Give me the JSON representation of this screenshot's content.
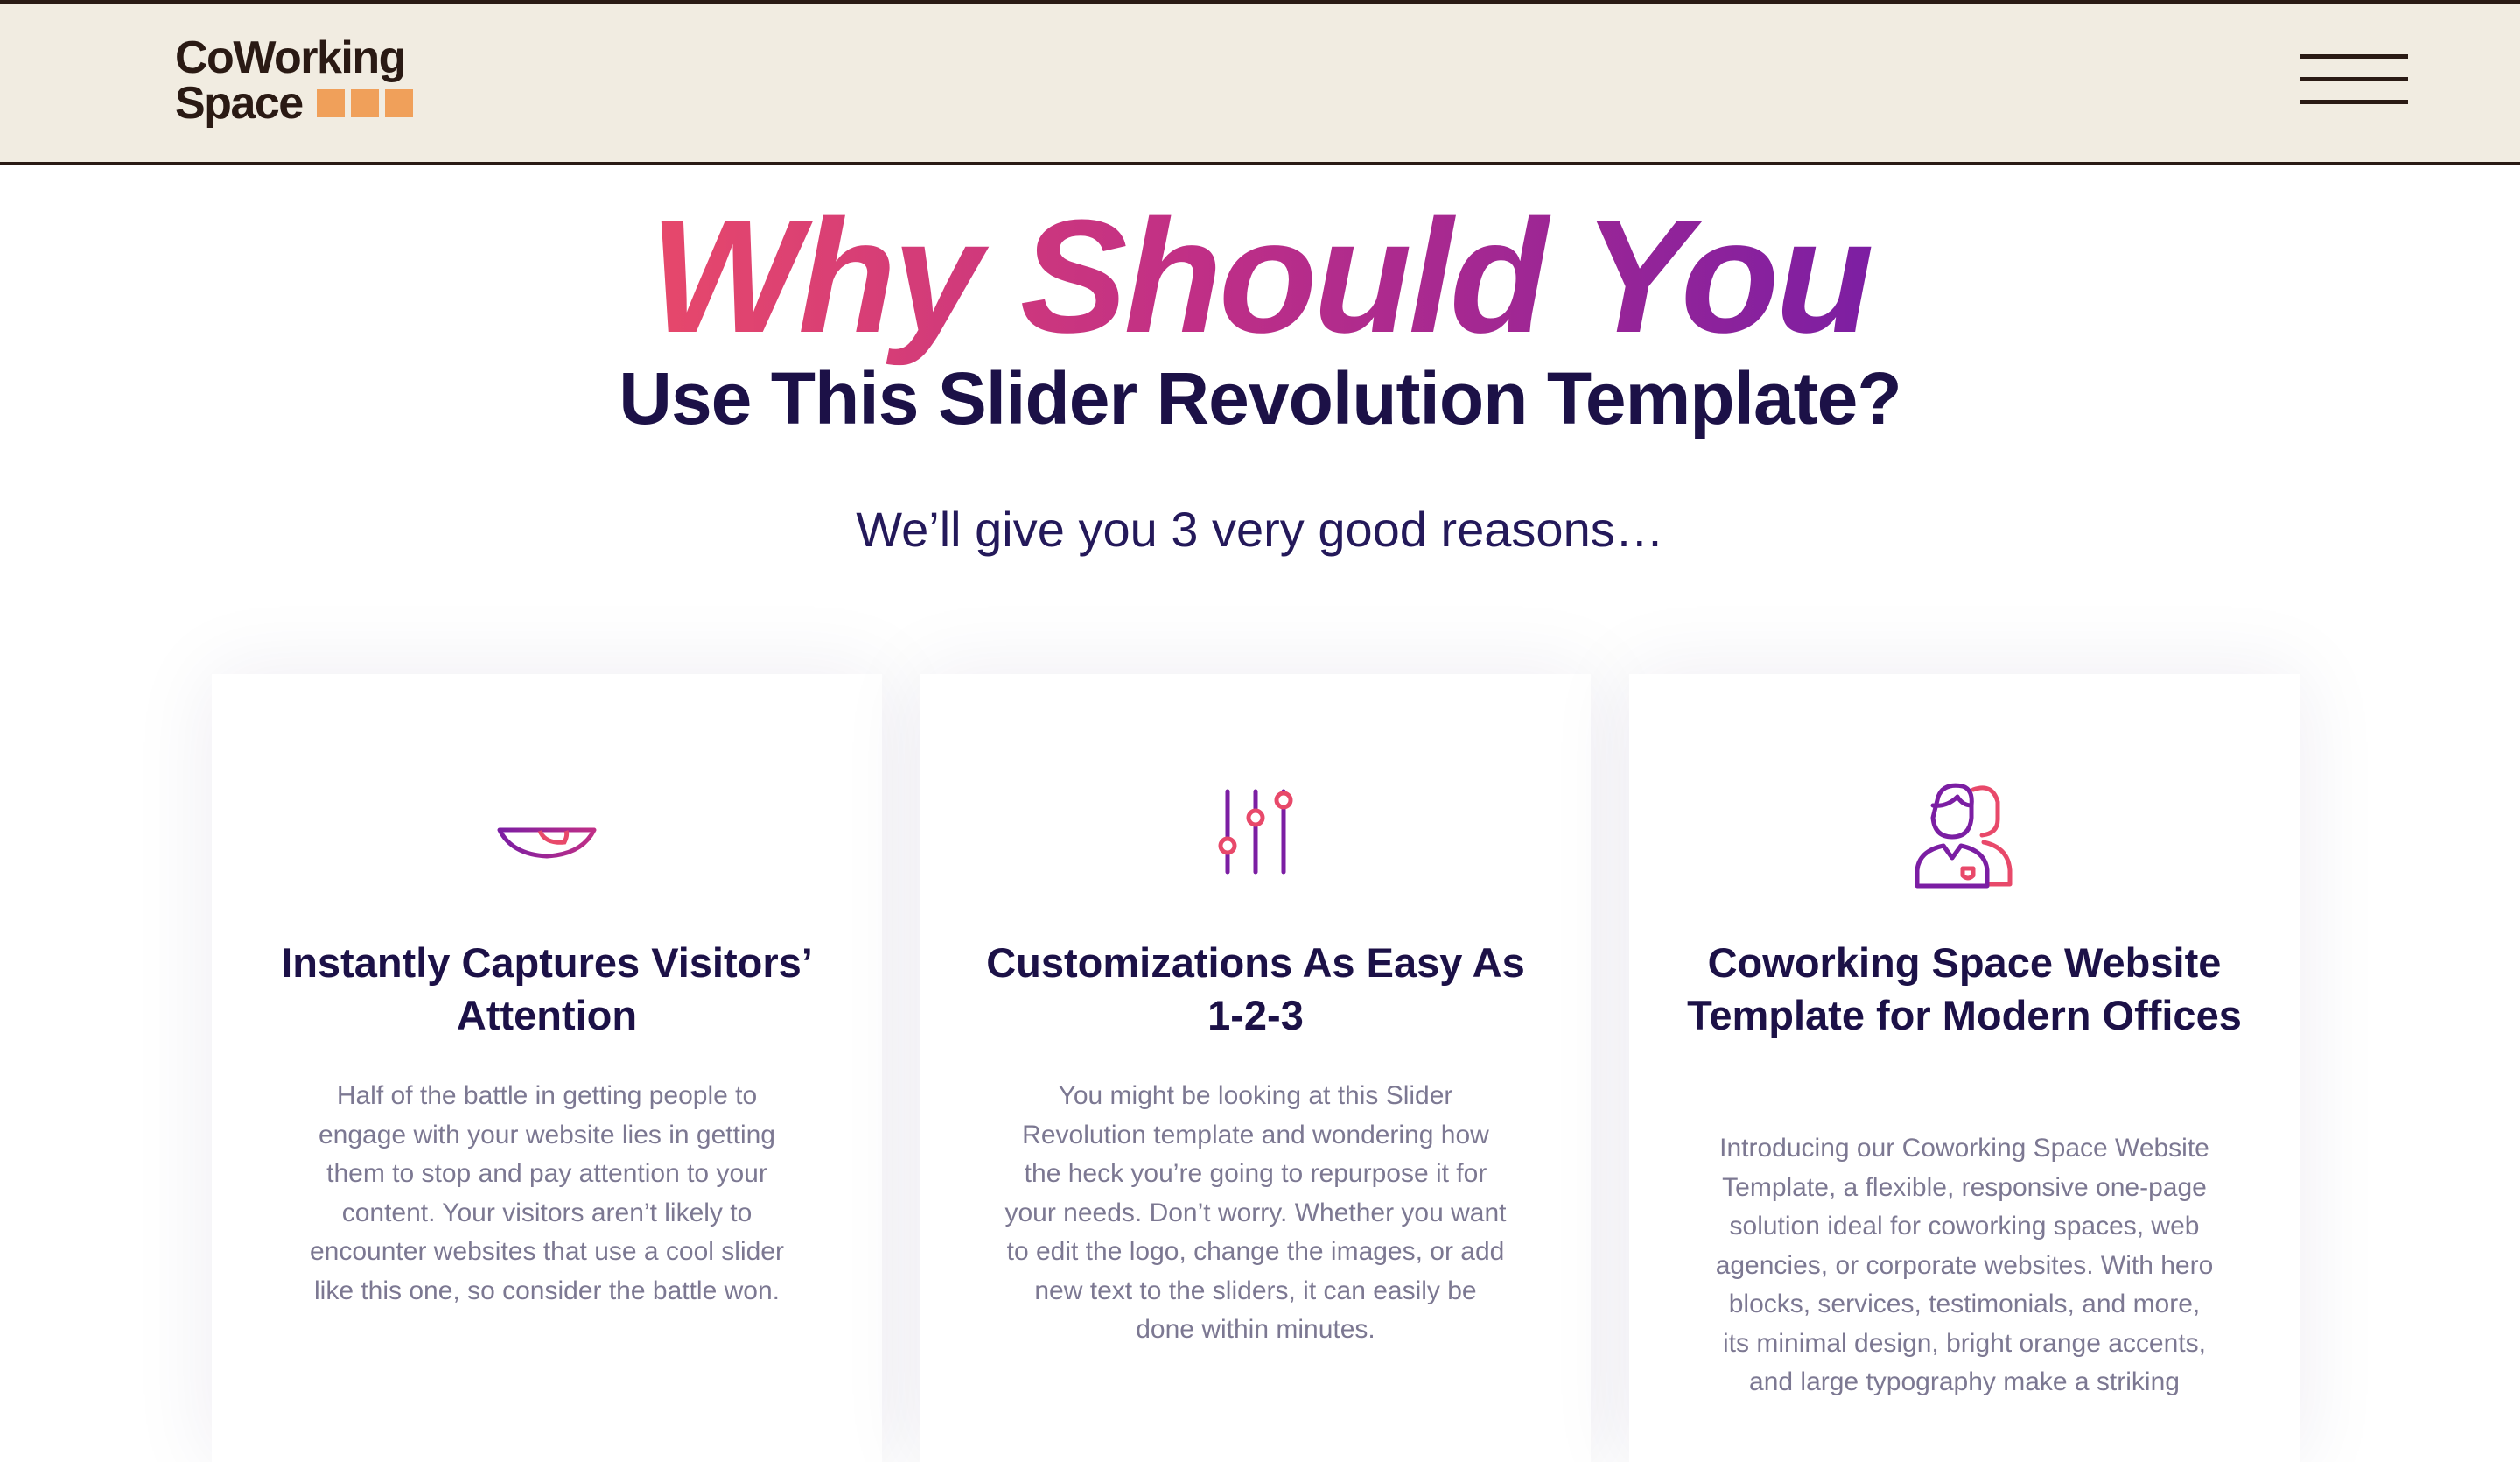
{
  "header": {
    "logo_line1": "CoWorking",
    "logo_line2": "Space"
  },
  "hero": {
    "headline": "Why Should You",
    "subheadline": "Use This Slider Revolution Template?",
    "intro": "We’ll give you 3 very good reasons…"
  },
  "cards": [
    {
      "icon": "eye-icon",
      "title": "Instantly Captures Visitors’ Attention",
      "body": "Half of the battle in getting people to engage with your website lies in getting them to stop and pay attention to your content. Your visitors aren’t likely to encounter websites that use a cool slider like this one, so consider the battle won."
    },
    {
      "icon": "sliders-icon",
      "title": "Customizations As Easy As 1-2-3",
      "body": "You might be looking at this Slider Revolution template and wondering how the heck you’re going to repurpose it for your needs. Don’t worry. Whether you want to edit the logo, change the images, or add new text to the sliders, it can easily be done within minutes."
    },
    {
      "icon": "users-icon",
      "title": "Coworking Space Website Template for Modern Offices",
      "body": "Introducing our Coworking Space Website Template, a flexible, responsive one-page solution ideal for coworking spaces, web agencies, or corporate websites. With hero blocks, services, testimonials, and more, its minimal design, bright orange accents, and large typography make a striking"
    }
  ],
  "colors": {
    "header_bg": "#f1ece1",
    "brand_dark": "#2a1a14",
    "accent_orange": "#f0a05a",
    "heading_navy": "#1c1147",
    "gradient_pink": "#e8496a",
    "gradient_purple": "#7b1ea3",
    "body_gray": "#7c7892"
  }
}
